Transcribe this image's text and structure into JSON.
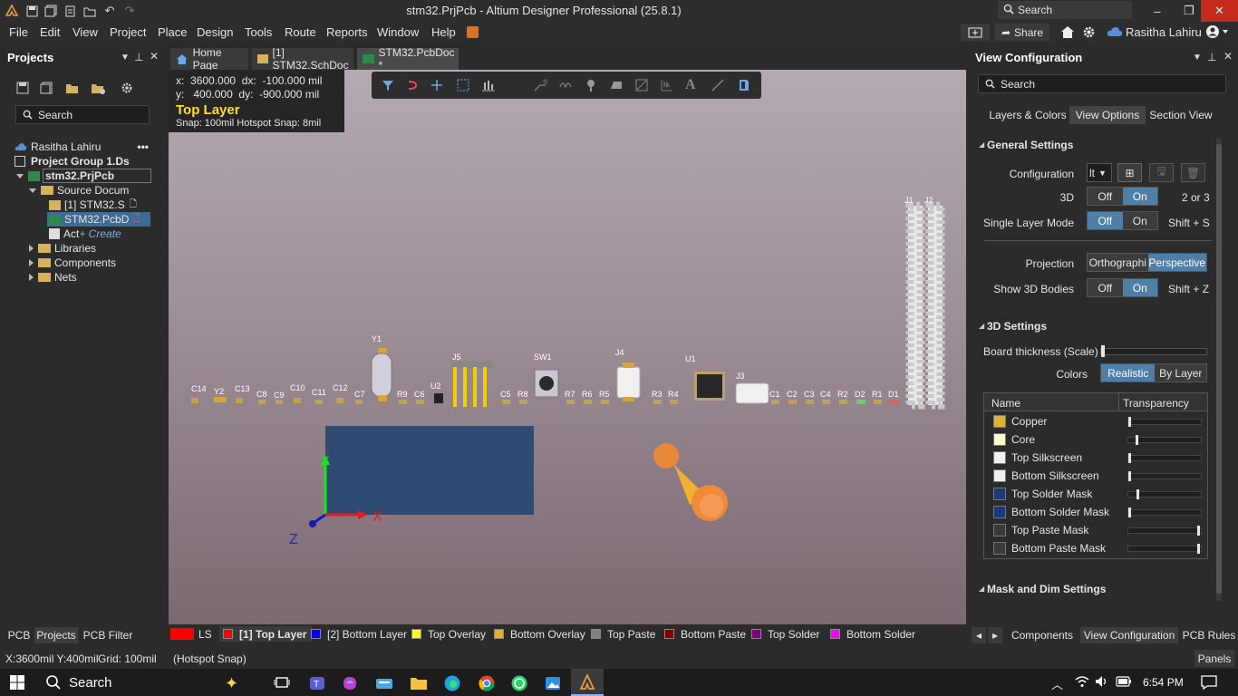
{
  "window": {
    "title": "stm32.PrjPcb - Altium Designer Professional (25.8.1)",
    "search_placeholder": "Search"
  },
  "menu": [
    "File",
    "Edit",
    "View",
    "Project",
    "Place",
    "Design",
    "Tools",
    "Route",
    "Reports",
    "Window",
    "Help"
  ],
  "menu_right": {
    "share_label": "Share",
    "user_name": "Rasitha Lahiru"
  },
  "projects_panel": {
    "title": "Projects",
    "search_placeholder": "Search",
    "tree": [
      {
        "label": "Rasitha Lahiru",
        "extra": "•••"
      },
      {
        "label": "Project Group 1.Ds"
      },
      {
        "label": "stm32.PrjPcb"
      },
      {
        "label": "Source Docum"
      },
      {
        "label": "[1] STM32.S"
      },
      {
        "label": "STM32.PcbD"
      },
      {
        "label": "Act",
        "extra": "+ Create"
      },
      {
        "label": "Libraries"
      },
      {
        "label": "Components"
      },
      {
        "label": "Nets"
      }
    ],
    "bottom_tabs": [
      "PCB",
      "Projects",
      "PCB Filter"
    ]
  },
  "doc_tabs": [
    {
      "label": "Home Page"
    },
    {
      "label": "[1] STM32.SchDoc"
    },
    {
      "label": "STM32.PcbDoc *"
    }
  ],
  "coordinates": {
    "x_label": "x:",
    "x_value": "3600.000",
    "dx_label": "dx:",
    "dx_value": "-100.000 mil",
    "y_label": "y:",
    "y_value": "400.000",
    "dy_label": "dy:",
    "dy_value": "-900.000 mil",
    "layer": "Top Layer",
    "snap": "Snap: 100mil Hotspot Snap: 8mil"
  },
  "components": [
    "C14",
    "Y2",
    "C13",
    "C8",
    "C9",
    "C10",
    "C11",
    "C12",
    "C7",
    "Y1",
    "R9",
    "C6",
    "U2",
    "J5",
    "C5",
    "R8",
    "SW1",
    "R7",
    "R6",
    "R5",
    "J4",
    "R3",
    "R4",
    "U1",
    "J3",
    "C1",
    "C2",
    "C3",
    "C4",
    "R2",
    "R1",
    "D2",
    "D1",
    "J1",
    "J2"
  ],
  "axis": {
    "x": "X",
    "y": "Y",
    "z": "Z"
  },
  "layer_tabs": [
    {
      "label": "LS",
      "color": "#ff0000"
    },
    {
      "label": "[1] Top Layer",
      "color": "#ff0000"
    },
    {
      "label": "[2] Bottom Layer",
      "color": "#0000ff"
    },
    {
      "label": "Top Overlay",
      "color": "#ffff00"
    },
    {
      "label": "Bottom Overlay",
      "color": "#e0b030"
    },
    {
      "label": "Top Paste",
      "color": "#808080"
    },
    {
      "label": "Bottom Paste",
      "color": "#800000"
    },
    {
      "label": "Top Solder",
      "color": "#800080"
    },
    {
      "label": "Bottom Solder",
      "color": "#ff00ff"
    }
  ],
  "view_config": {
    "title": "View Configuration",
    "search_placeholder": "Search",
    "tabs": [
      "Layers & Colors",
      "View Options",
      "Section View"
    ],
    "general_settings_title": "General Settings",
    "configuration_label": "Configuration",
    "configuration_value": "lt",
    "three_d_label": "3D",
    "off": "Off",
    "on": "On",
    "three_d_shortcut": "2 or 3",
    "single_layer_label": "Single Layer Mode",
    "single_layer_shortcut": "Shift + S",
    "projection_label": "Projection",
    "projection_ortho": "Orthographi",
    "projection_persp": "Perspective",
    "show3d_label": "Show 3D Bodies",
    "show3d_shortcut": "Shift + Z",
    "settings3d_title": "3D Settings",
    "board_thickness_label": "Board thickness (Scale)",
    "board_thickness_level": 0.0,
    "colors_label": "Colors",
    "colors_realistic": "Realistic",
    "colors_by_layer": "By Layer",
    "table_headers": [
      "Name",
      "Transparency"
    ],
    "layers": [
      {
        "name": "Copper",
        "color": "#e0b030",
        "transparency": 0.0
      },
      {
        "name": "Core",
        "color": "#fffacd",
        "transparency": 0.1
      },
      {
        "name": "Top Silkscreen",
        "color": "#f0f0f0",
        "transparency": 0.0
      },
      {
        "name": "Bottom Silkscreen",
        "color": "#f0f0f0",
        "transparency": 0.0
      },
      {
        "name": "Top Solder Mask",
        "color": "#1a3a7a",
        "transparency": 0.12
      },
      {
        "name": "Bottom Solder Mask",
        "color": "#1a3a7a",
        "transparency": 0.0
      },
      {
        "name": "Top Paste Mask",
        "color": "#3a3a3a",
        "transparency": 0.97
      },
      {
        "name": "Bottom Paste Mask",
        "color": "#3a3a3a",
        "transparency": 0.97
      }
    ],
    "mask_title": "Mask and Dim Settings",
    "bottom_tabs": [
      "Components",
      "View Configuration",
      "PCB Rules"
    ]
  },
  "status": {
    "position": "X:3600mil Y:400mil",
    "grid": "Grid: 100mil",
    "snap": "(Hotspot Snap)",
    "panels": "Panels"
  },
  "taskbar": {
    "search_label": "Search",
    "time": "6:54 PM"
  }
}
